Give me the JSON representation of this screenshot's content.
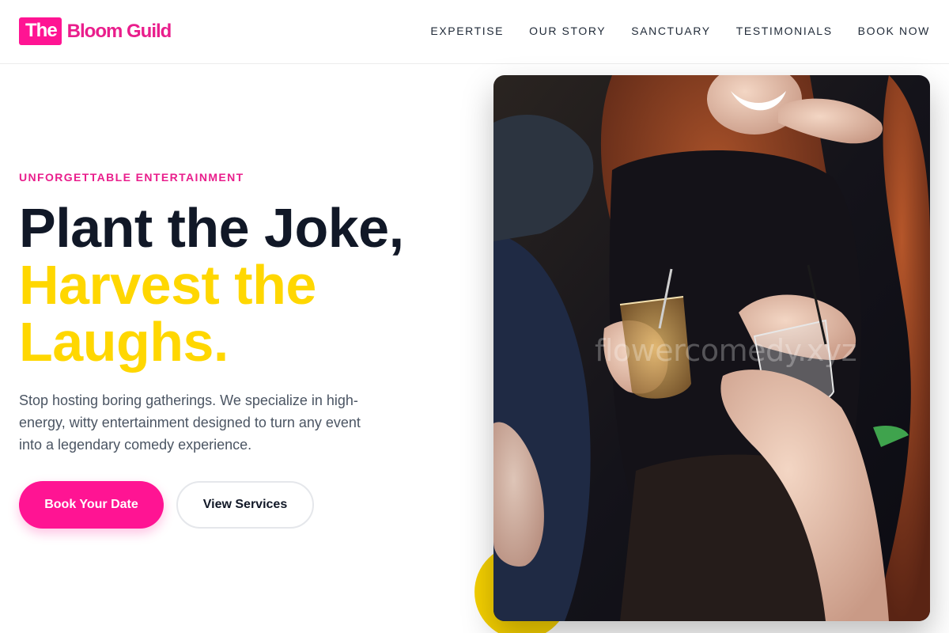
{
  "brand": {
    "badge": "The",
    "name": "Bloom Guild"
  },
  "nav": [
    {
      "label": "EXPERTISE"
    },
    {
      "label": "OUR STORY"
    },
    {
      "label": "SANCTUARY"
    },
    {
      "label": "TESTIMONIALS"
    },
    {
      "label": "BOOK NOW"
    }
  ],
  "hero": {
    "eyebrow": "UNFORGETTABLE ENTERTAINMENT",
    "headline_line1": "Plant the Joke,",
    "headline_line2": "Harvest the",
    "headline_line3": "Laughs.",
    "description": "Stop hosting boring gatherings. We specialize in high-energy, witty entertainment designed to turn any event into a legendary comedy experience.",
    "primary_cta": "Book Your Date",
    "secondary_cta": "View Services"
  },
  "image": {
    "watermark": "flowercomedy.xyz",
    "subject": "people-toasting-drinks-photo"
  },
  "colors": {
    "accent_pink": "#ff1493",
    "accent_yellow": "#ffd700",
    "text_dark": "#111827",
    "text_muted": "#4b5563"
  }
}
